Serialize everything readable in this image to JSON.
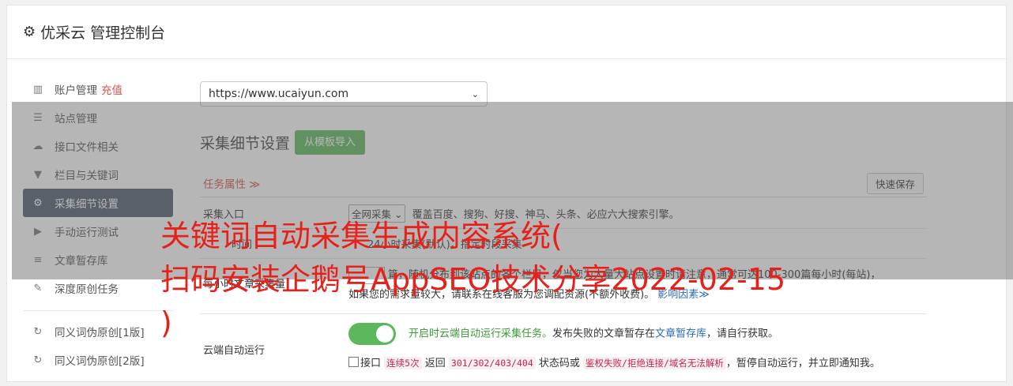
{
  "header": {
    "title": "优采云 管理控制台",
    "icon": "gear-icon"
  },
  "sidebar": {
    "items": [
      {
        "label": "账户管理",
        "extra": "充值",
        "icon": "bar-chart-icon"
      },
      {
        "label": "站点管理",
        "icon": "server-icon"
      },
      {
        "label": "接口文件相关",
        "icon": "cloud-upload-icon"
      },
      {
        "label": "栏目与关键词",
        "icon": "filter-icon"
      },
      {
        "label": "采集细节设置",
        "icon": "gears-icon",
        "active": true
      },
      {
        "label": "手动运行测试",
        "icon": "play-circle-icon"
      },
      {
        "label": "文章暂存库",
        "icon": "database-icon"
      },
      {
        "label": "深度原创任务",
        "icon": "edit-icon"
      },
      {
        "label": "同义词伪原创[1版]",
        "icon": "refresh-icon"
      },
      {
        "label": "同义词伪原创[2版]",
        "icon": "refresh-icon"
      }
    ]
  },
  "main": {
    "site_select": "https://www.ucaiyun.com",
    "section_title": "采集细节设置",
    "import_button": "从模板导入",
    "task_attr_label": "任务属性 ≫",
    "quick_save": "快速保存",
    "entry": {
      "label": "采集入口",
      "select_value": "全网采集",
      "hint": "覆盖百度、搜狗、好搜、神马、头条、必应六大搜索引擎。"
    },
    "row_time": {
      "label": "时间",
      "text": "24小时采集(默认)，指定时段采集"
    },
    "row_amount": {
      "label": "每小时文章采集量",
      "text": "篇，随机分布到该站点的各个栏目，仅当您为大量大站点设置时请注意，通常可达100-300篇每小时(每站)，",
      "line2": "如果您的需求量较大，请联系在线客服为您调配资源(不额外收费)。",
      "link": "影响因素≫"
    },
    "cloud": {
      "label": "云端自动运行",
      "enabled_text": "开启时云端自动运行采集任务。",
      "desc_pre": "发布失败的文章暂存在",
      "desc_link": "文章暂存库",
      "desc_post": "，请自行获取。",
      "chk_label": "接口",
      "tag1": "连续5次",
      "txt1": "返回",
      "tag2": "301/302/403/404",
      "txt2": "状态码或",
      "tag3": "鉴权失败/拒绝连接/域名无法解析",
      "txt3": "，暂停自动运行，并立即通知我。"
    }
  },
  "watermark": {
    "line1": "关键词自动采集生成内容系统(",
    "line2": "扫码安装企鹅号AppSEO技术分享2022-02-15",
    "line3": ")"
  },
  "colors": {
    "accent_green": "#5cb85c",
    "active_item": "#4d5b6b",
    "red": "#d9534f",
    "watermark": "#e8201a"
  }
}
